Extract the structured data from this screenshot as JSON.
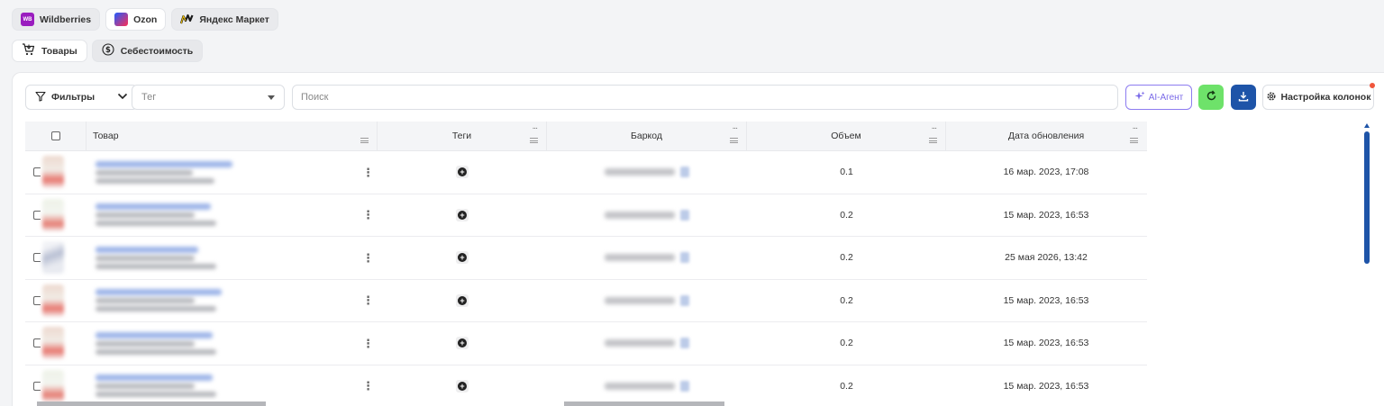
{
  "marketplaces": [
    {
      "label": "Wildberries",
      "logo": "WB",
      "active": false
    },
    {
      "label": "Ozon",
      "logo": "ozon",
      "active": true
    },
    {
      "label": "Яндекс Маркет",
      "logo": "ym",
      "active": false
    }
  ],
  "sections": [
    {
      "label": "Товары",
      "icon": "cart-icon",
      "selected": false
    },
    {
      "label": "Себестоимость",
      "icon": "dollar-icon",
      "selected": true
    }
  ],
  "toolbar": {
    "filters_label": "Фильтры",
    "tag_placeholder": "Тег",
    "search_placeholder": "Поиск",
    "ai_label": "AI-Агент",
    "columns_label": "Настройка колонок"
  },
  "table": {
    "columns": {
      "product": "Товар",
      "tags": "Теги",
      "barcode": "Баркод",
      "volume": "Объем",
      "updated": "Дата обновления"
    },
    "rows": [
      {
        "volume": "0.1",
        "updated": "16 мар. 2023, 17:08"
      },
      {
        "volume": "0.2",
        "updated": "15 мар. 2023, 16:53"
      },
      {
        "volume": "0.2",
        "updated": "25 мая 2026, 13:42"
      },
      {
        "volume": "0.2",
        "updated": "15 мар. 2023, 16:53"
      },
      {
        "volume": "0.2",
        "updated": "15 мар. 2023, 16:53"
      },
      {
        "volume": "0.2",
        "updated": "15 мар. 2023, 16:53"
      }
    ]
  },
  "colors": {
    "accent_blue": "#1e54a8",
    "refresh_green": "#6ee26a",
    "ai_purple": "#7a6ae8",
    "notification": "#f0563c"
  }
}
